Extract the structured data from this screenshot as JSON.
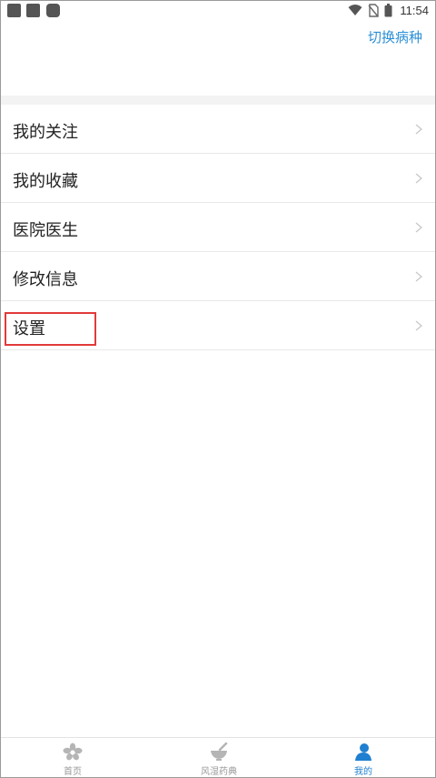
{
  "status_bar": {
    "time": "11:54"
  },
  "header": {
    "switch_disease": "切换病种"
  },
  "menu": {
    "items": [
      {
        "label": "我的关注"
      },
      {
        "label": "我的收藏"
      },
      {
        "label": "医院医生"
      },
      {
        "label": "修改信息"
      },
      {
        "label": "设置"
      }
    ]
  },
  "tabs": [
    {
      "label": "首页",
      "icon": "flower-icon"
    },
    {
      "label": "风湿药典",
      "icon": "mortar-bowl-icon"
    },
    {
      "label": "我的",
      "icon": "person-icon",
      "active": true
    }
  ],
  "colors": {
    "accent": "#2b8fd6",
    "highlight": "#e23a3a"
  }
}
